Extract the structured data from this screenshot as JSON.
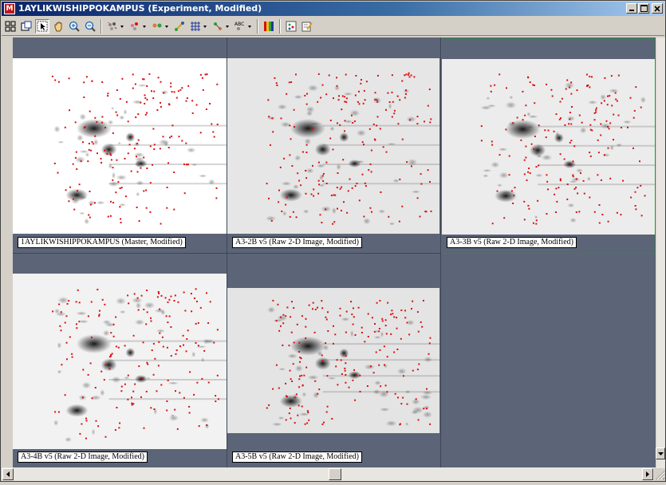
{
  "window": {
    "title": "1AYLIKWISHIPPOKAMPUS (Experiment, Modified)",
    "icon": "app-logo-icon",
    "controls": [
      "minimize-icon",
      "maximize-icon",
      "close-icon"
    ]
  },
  "toolbar": {
    "tools": [
      {
        "name": "layout-grid-icon",
        "pressed": false
      },
      {
        "name": "layout-window-icon",
        "pressed": false
      },
      {
        "name": "select-arrow-icon",
        "pressed": true
      },
      {
        "name": "pan-hand-icon",
        "pressed": false
      },
      {
        "name": "zoom-in-icon",
        "pressed": false
      },
      {
        "name": "zoom-out-icon",
        "pressed": false
      },
      {
        "name": "spot-detect-icon",
        "dropdown": true
      },
      {
        "name": "spot-edit-icon",
        "dropdown": true
      },
      {
        "name": "spot-pair-icon",
        "dropdown": true
      },
      {
        "name": "match-link-icon",
        "dropdown": false
      },
      {
        "name": "grid-icon",
        "dropdown": true
      },
      {
        "name": "landmark-icon",
        "dropdown": true
      },
      {
        "name": "label-abc-icon",
        "dropdown": true
      },
      {
        "name": "color-bars-icon",
        "dropdown": false
      },
      {
        "name": "spot-table-icon",
        "dropdown": false
      },
      {
        "name": "report-edit-icon",
        "dropdown": false
      }
    ]
  },
  "panes": [
    {
      "label": "1AYLIKWISHIPPOKAMPUS (Master, Modified)",
      "selected": false
    },
    {
      "label": "A3-2B v5 (Raw 2-D Image, Modified)",
      "selected": false
    },
    {
      "label": "A3-3B v5 (Raw 2-D Image, Modified)",
      "selected": true
    },
    {
      "label": "A3-4B v5 (Raw 2-D Image, Modified)",
      "selected": false
    },
    {
      "label": "A3-5B v5 (Raw 2-D Image, Modified)",
      "selected": false
    }
  ],
  "colors": {
    "background": "#5c6477",
    "selection": "#1a9b2a",
    "spot_marker": "#d81010",
    "titlebar": "#0a246a"
  }
}
